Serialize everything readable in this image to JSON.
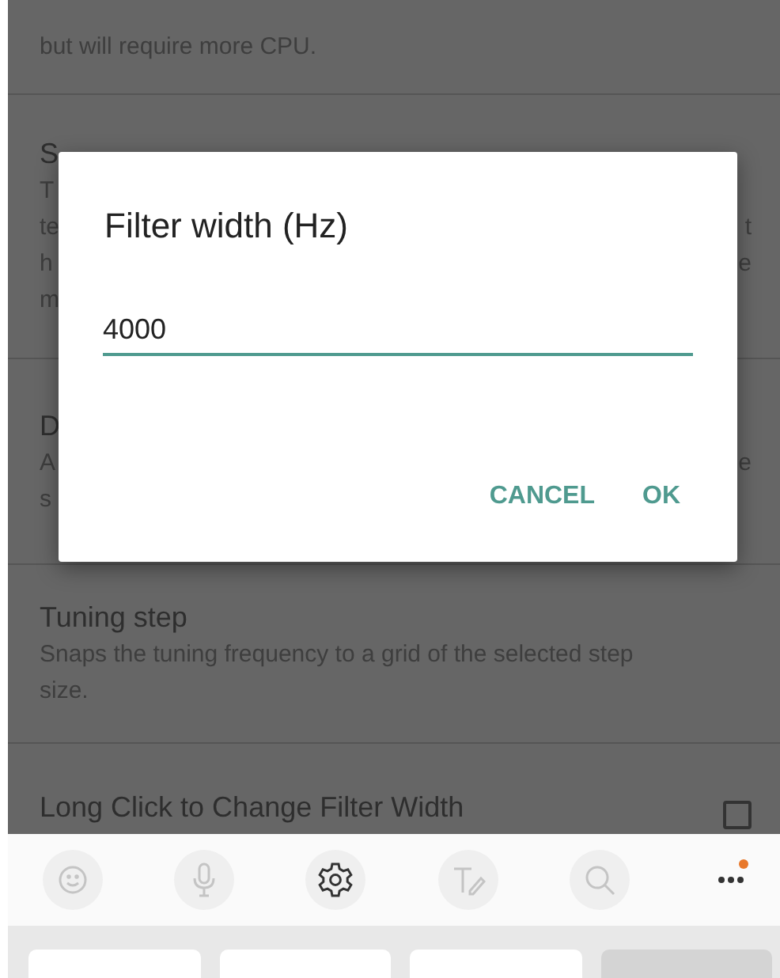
{
  "settings": [
    {
      "lines": [
        {
          "left": "but will require more CPU."
        }
      ]
    },
    {
      "title": "S",
      "lines": [
        {
          "left": "T"
        },
        {
          "left": "te",
          "right": "t"
        },
        {
          "left": "h",
          "right": "e"
        },
        {
          "left": "m"
        }
      ]
    },
    {
      "title": "D",
      "lines": [
        {
          "left": "A",
          "right": "e"
        },
        {
          "left": "s"
        }
      ]
    },
    {
      "title": "Tuning step",
      "lines": [
        {
          "left": "Snaps the tuning frequency to a grid of the selected step"
        },
        {
          "left": "size."
        }
      ]
    },
    {
      "title": "Long Click to Change Filter Width",
      "checkbox": {
        "checked": false
      }
    }
  ],
  "dialog": {
    "title": "Filter width (Hz)",
    "field": {
      "value": "4000"
    },
    "buttons": [
      "CANCEL",
      "OK"
    ]
  },
  "keyboard_toolbar": [
    {
      "kind": "emoji",
      "disabled": true
    },
    {
      "kind": "mic",
      "disabled": true
    },
    {
      "kind": "settings",
      "disabled": false
    },
    {
      "kind": "handwriting",
      "disabled": true
    },
    {
      "kind": "search",
      "disabled": true
    },
    {
      "kind": "more",
      "disabled": false
    }
  ],
  "keys": [
    {
      "disabled": false
    },
    {
      "disabled": false
    },
    {
      "disabled": false
    },
    {
      "disabled": true
    }
  ]
}
